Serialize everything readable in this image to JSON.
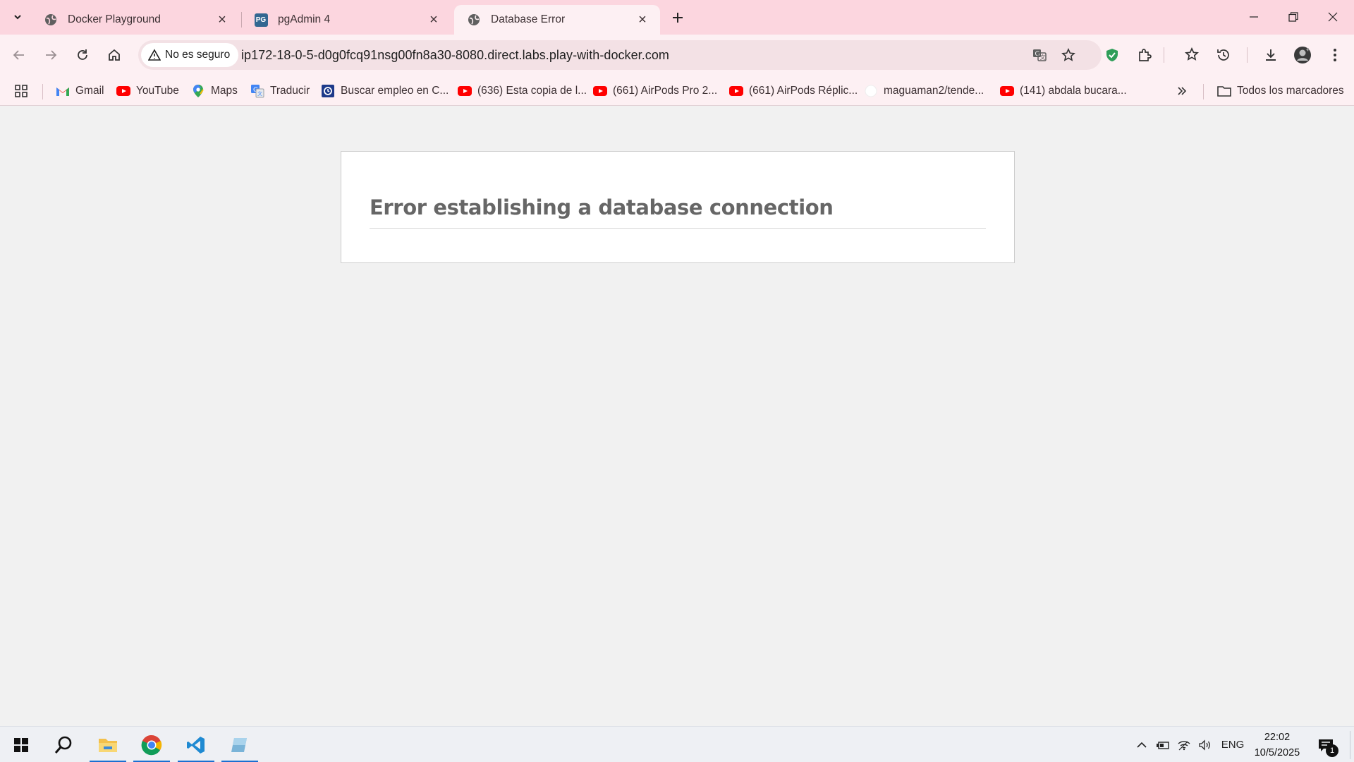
{
  "browser": {
    "tabs": [
      {
        "title": "Docker Playground",
        "favicon": "globe-icon",
        "active": false
      },
      {
        "title": "pgAdmin 4",
        "favicon": "pgadmin-icon",
        "active": false
      },
      {
        "title": "Database Error",
        "favicon": "globe-icon",
        "active": true
      }
    ],
    "security_chip": "No es seguro",
    "url": "ip172-18-0-5-d0g0fcq91nsg00fn8a30-8080.direct.labs.play-with-docker.com",
    "pgadmin_favicon_text": "PG",
    "bookmarks": [
      {
        "label": "Gmail",
        "icon": "gmail-icon"
      },
      {
        "label": "YouTube",
        "icon": "youtube-icon"
      },
      {
        "label": "Maps",
        "icon": "maps-icon"
      },
      {
        "label": "Traducir",
        "icon": "translate-icon"
      },
      {
        "label": "Buscar empleo en C...",
        "icon": "job-search-icon"
      },
      {
        "label": "(636) Esta copia de l...",
        "icon": "youtube-icon"
      },
      {
        "label": "(661) AirPods Pro 2...",
        "icon": "youtube-icon"
      },
      {
        "label": "(661) AirPods Réplic...",
        "icon": "youtube-icon"
      },
      {
        "label": "maguaman2/tende...",
        "icon": "github-icon"
      },
      {
        "label": "(141) abdala bucara...",
        "icon": "youtube-icon"
      }
    ],
    "all_bookmarks": "Todos los marcadores"
  },
  "page": {
    "error_heading": "Error establishing a database connection"
  },
  "taskbar": {
    "language": "ENG",
    "time": "22:02",
    "date": "10/5/2025",
    "notification_count": "1"
  },
  "colors": {
    "tabstrip": "#fcd6df",
    "toolbar": "#fdf0f3",
    "page_background": "#f1f1f1",
    "heading": "#666666"
  }
}
